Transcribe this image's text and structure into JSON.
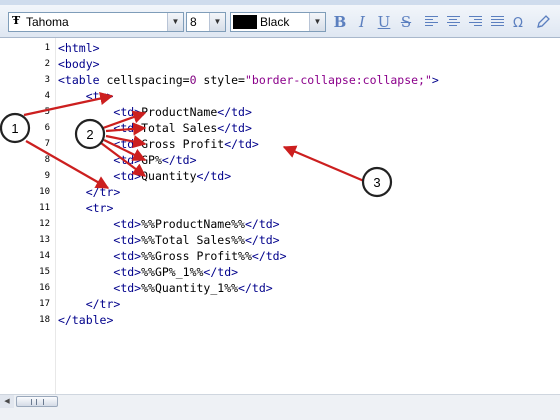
{
  "toolbar": {
    "font_name": "Tahoma",
    "font_icon_glyph": "Ŧ",
    "font_size": "8",
    "color_name": "Black",
    "color_hex": "#000000",
    "bold_label": "B",
    "italic_label": "I",
    "underline_label": "U",
    "strike_label": "S",
    "special_char_label": "Ω",
    "dropdown_glyph": "▼",
    "accent_color": "#5b7fbf"
  },
  "editor": {
    "line_numbers": [
      "1",
      "2",
      "3",
      "4",
      "5",
      "6",
      "7",
      "8",
      "9",
      "10",
      "11",
      "12",
      "13",
      "14",
      "15",
      "16",
      "17",
      "18"
    ],
    "lines": [
      "<html>",
      "<body>",
      "<table cellspacing=0 style=\"border-collapse:collapse;\">",
      "    <tr>",
      "        <td>ProductName</td>",
      "        <td>Total Sales</td>",
      "        <td>Gross Profit</td>",
      "        <td>GP%</td>",
      "        <td>Quantity</td>",
      "    </tr>",
      "    <tr>",
      "        <td>%%ProductName%%</td>",
      "        <td>%%Total Sales%%</td>",
      "        <td>%%Gross Profit%%</td>",
      "        <td>%%GP%_1%%</td>",
      "        <td>%%Quantity_1%%</td>",
      "    </tr>",
      "</table>"
    ],
    "colors": {
      "tag": "#00008b",
      "attribute_value": "#8b008b",
      "number": "#800080"
    }
  },
  "annotations": {
    "callout_labels": [
      "1",
      "2",
      "3"
    ],
    "arrow_color": "#cc1f1f"
  },
  "scrollbar": {
    "left_arrow_glyph": "◀"
  }
}
